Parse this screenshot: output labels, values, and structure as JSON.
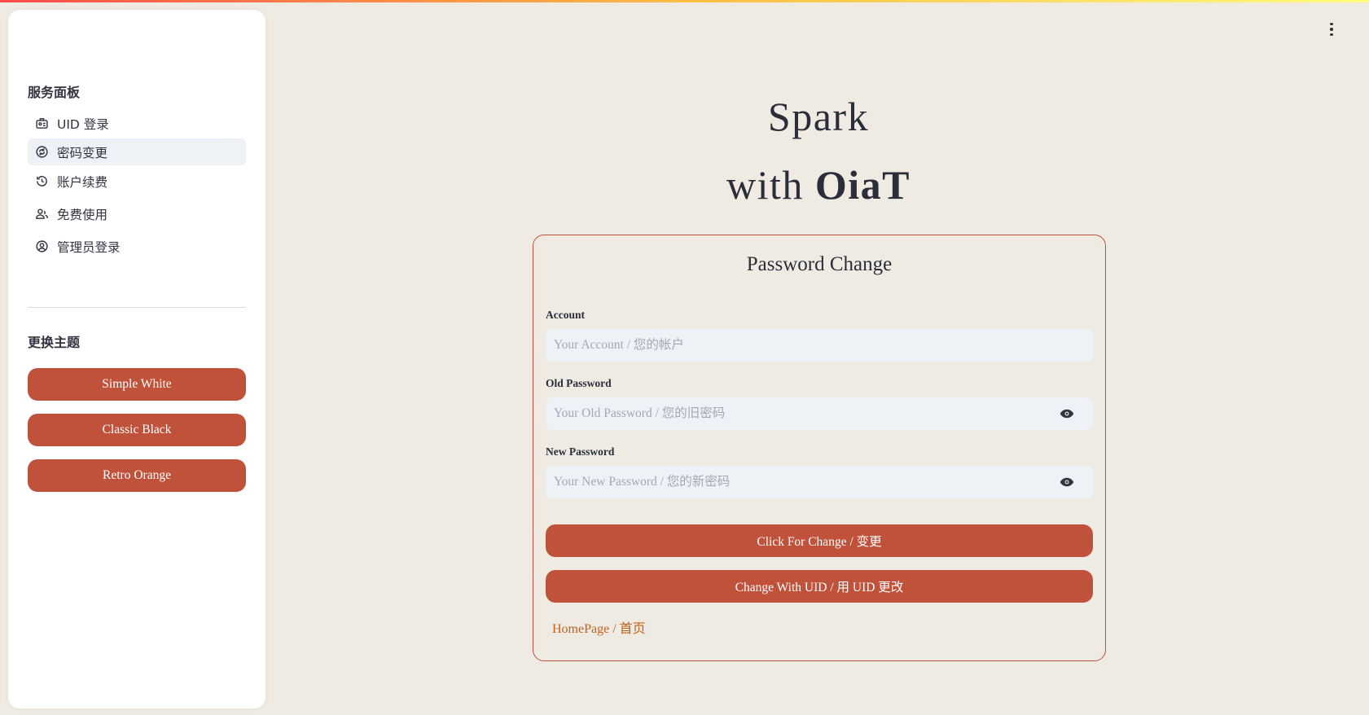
{
  "sidebar": {
    "service_heading": "服务面板",
    "items": [
      {
        "label": "UID 登录",
        "icon": "id-card-icon"
      },
      {
        "label": "密码变更",
        "icon": "password-change-icon"
      },
      {
        "label": "账户续费",
        "icon": "history-icon"
      },
      {
        "label": "免费使用",
        "icon": "user-group-icon"
      },
      {
        "label": "管理员登录",
        "icon": "account-circle-icon"
      }
    ],
    "theme_heading": "更换主题",
    "themes": [
      "Simple White",
      "Classic Black",
      "Retro Orange"
    ]
  },
  "main": {
    "title_line1": "Spark",
    "title_line2_prefix": "with ",
    "title_line2_brand": "OiaT"
  },
  "form": {
    "title": "Password Change",
    "account_label": "Account",
    "account_placeholder": "Your Account / 您的帐户",
    "old_password_label": "Old Password",
    "old_password_placeholder": "Your Old Password / 您的旧密码",
    "new_password_label": "New Password",
    "new_password_placeholder": "Your New Password / 您的新密码",
    "submit_label": "Click For Change / 变更",
    "uid_change_label": "Change With UID / 用 UID 更改",
    "homepage_link": "HomePage / 首页"
  },
  "colors": {
    "accent": "#c0513b",
    "background": "#efebe3",
    "link": "#c0611b",
    "input_bg": "#eef1f6"
  }
}
